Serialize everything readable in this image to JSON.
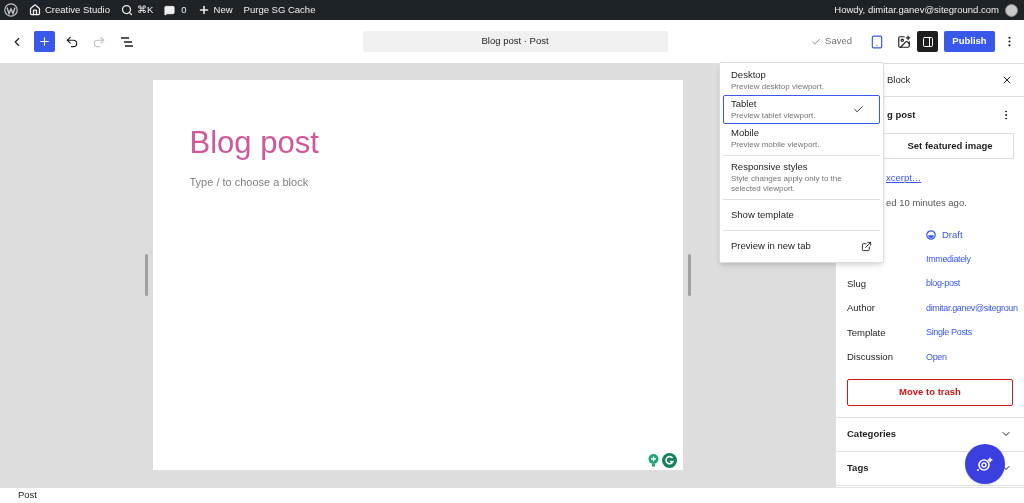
{
  "admin_bar": {
    "items": [
      {
        "kind": "logo"
      },
      {
        "kind": "site",
        "label": "Creative Studio"
      },
      {
        "kind": "search",
        "label": "⌘K"
      },
      {
        "kind": "comments",
        "label": "0"
      },
      {
        "kind": "new",
        "label": "New"
      },
      {
        "kind": "text",
        "label": "Purge SG Cache"
      }
    ],
    "greeting": "Howdy, dimitar.ganev@siteground.com"
  },
  "toolbar": {
    "undo": {
      "disabled": false
    },
    "redo": {
      "disabled": true
    },
    "document_title": "Blog post · Post",
    "save_status": "Saved",
    "sidebar_toggle": {
      "on": true
    },
    "publish": "Publish"
  },
  "canvas": {
    "title": "Blog post",
    "placeholder": "Type / to choose a block"
  },
  "preview_menu": {
    "sections": [
      [
        {
          "label": "Desktop",
          "description": "Preview desktop viewport.",
          "selected": false
        },
        {
          "label": "Tablet",
          "description": "Preview tablet viewport.",
          "selected": true
        },
        {
          "label": "Mobile",
          "description": "Preview mobile viewport.",
          "selected": false
        }
      ],
      [
        {
          "label": "Responsive styles",
          "description": "Style changes apply only to the selected viewport."
        }
      ],
      [
        {
          "label": "Show template"
        }
      ],
      [
        {
          "label": "Preview in new tab",
          "kind": "external"
        }
      ]
    ]
  },
  "sidebar": {
    "tab": {
      "label": "Block",
      "selected": false
    },
    "post_title": "g post",
    "featured_button": "Set featured image",
    "excerpt_link": "xcerpt…",
    "last_edited": "ed 10 minutes ago.",
    "fields": [
      {
        "kind": "status",
        "value": "Draft"
      },
      {
        "kind": "plain",
        "value": "Immediately"
      },
      {
        "kind": "plain",
        "label": "Slug",
        "value": "blog-post"
      },
      {
        "kind": "plain",
        "label": "Author",
        "value": "dimitar.ganev@sitegroun"
      },
      {
        "kind": "plain",
        "label": "Template",
        "value": "Single Posts"
      },
      {
        "kind": "plain",
        "label": "Discussion",
        "value": "Open"
      }
    ],
    "trash_button": "Move to trash",
    "panels": [
      {
        "title": "Categories",
        "expanded": false
      },
      {
        "title": "Tags",
        "expanded": false
      }
    ]
  },
  "status_bar": "Post"
}
